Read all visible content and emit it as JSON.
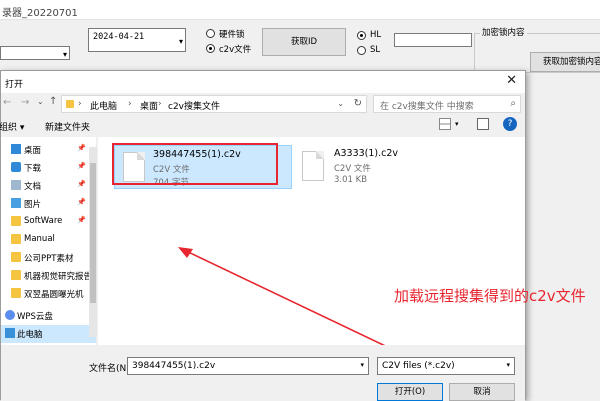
{
  "app": {
    "title": "录器_20220701",
    "date_value": "2024-04-21",
    "lock_type_options": [
      {
        "label": "硬件锁",
        "selected": false
      },
      {
        "label": "c2v文件",
        "selected": true
      }
    ],
    "get_id_label": "获取ID",
    "hl_sl_options": [
      {
        "label": "HL",
        "selected": true
      },
      {
        "label": "SL",
        "selected": false
      }
    ],
    "enc_group_label": "加密锁内容",
    "get_enc_button_label": "获取加密锁内容"
  },
  "dialog": {
    "title": "打开",
    "address": {
      "path": [
        "此电脑",
        "桌面",
        "c2v搜集文件"
      ],
      "search_placeholder": "在 c2v搜集文件 中搜索"
    },
    "toolbar": {
      "organize_label": "组织 ▾",
      "new_folder_label": "新建文件夹"
    },
    "nav_items": [
      {
        "label": "桌面",
        "icon": "desktop-icon",
        "pinned": true
      },
      {
        "label": "下载",
        "icon": "download-icon",
        "pinned": true
      },
      {
        "label": "文档",
        "icon": "document-icon",
        "pinned": true
      },
      {
        "label": "图片",
        "icon": "picture-icon",
        "pinned": true
      },
      {
        "label": "SoftWare",
        "icon": "folder-icon",
        "pinned": true
      },
      {
        "label": "Manual",
        "icon": "folder-icon",
        "pinned": false
      },
      {
        "label": "公司PPT素材",
        "icon": "folder-icon",
        "pinned": false
      },
      {
        "label": "机器视觉研究报告",
        "icon": "folder-icon",
        "pinned": false
      },
      {
        "label": "双翌晶圆曝光机",
        "icon": "folder-icon",
        "pinned": false
      },
      {
        "label": "WPS云盘",
        "icon": "cloud-icon",
        "pinned": false
      },
      {
        "label": "此电脑",
        "icon": "computer-icon",
        "pinned": false
      }
    ],
    "files": [
      {
        "name": "398447455(1).c2v",
        "type": "C2V 文件",
        "size": "704 字节",
        "selected": true
      },
      {
        "name": "A3333(1).c2v",
        "type": "C2V 文件",
        "size": "3.01 KB",
        "selected": false
      }
    ],
    "filename_label": "文件名(N):",
    "filename_value": "398447455(1).c2v",
    "filetype_value": "C2V files (*.c2v)",
    "open_button_label": "打开(O)",
    "cancel_button_label": "取消"
  },
  "annotation": {
    "text": "加载远程搜集得到的c2v文件",
    "color": "#e8262f"
  },
  "colors": {
    "selection_bg": "#cce8ff",
    "selection_border": "#99d1ff",
    "annotation_red": "#e8262f"
  }
}
